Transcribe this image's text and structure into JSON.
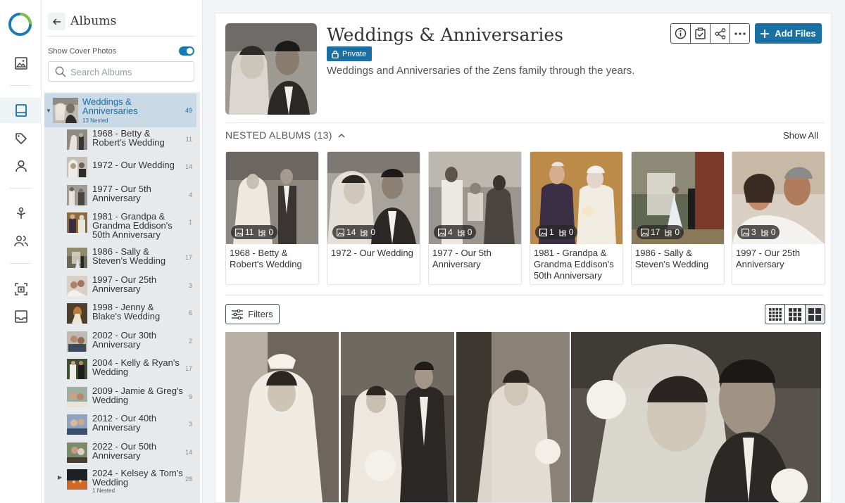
{
  "sidebar": {
    "title": "Albums",
    "show_cover_label": "Show Cover Photos",
    "search_placeholder": "Search Albums",
    "root": {
      "name": "Weddings & Anniversaries",
      "sub": "13 Nested",
      "count": "49"
    },
    "items": [
      {
        "name": "1968 - Betty & Robert's Wedding",
        "count": "11"
      },
      {
        "name": "1972 - Our Wedding",
        "count": "14"
      },
      {
        "name": "1977 - Our 5th Anniversary",
        "count": "4"
      },
      {
        "name": "1981 - Grandpa & Grandma Eddison's 50th Anniversary",
        "count": "1"
      },
      {
        "name": "1986 - Sally & Steven's Wedding",
        "count": "17"
      },
      {
        "name": "1997 - Our 25th Anniversary",
        "count": "3"
      },
      {
        "name": "1998 - Jenny & Blake's Wedding",
        "count": "6"
      },
      {
        "name": "2002 - Our 30th Anniversary",
        "count": "2"
      },
      {
        "name": "2004 - Kelly & Ryan's Wedding",
        "count": "17"
      },
      {
        "name": "2009 - Jamie & Greg's Wedding",
        "count": "9"
      },
      {
        "name": "2012 - Our 40th Anniversary",
        "count": "3"
      },
      {
        "name": "2022 - Our 50th Anniversary",
        "count": "14"
      },
      {
        "name": "2024 - Kelsey & Tom's Wedding",
        "count": "28",
        "sub": "1 Nested"
      }
    ]
  },
  "album": {
    "title": "Weddings & Anniversaries",
    "privacy": "Private",
    "description": "Weddings and Anniversaries of the Zens family through the years.",
    "add_files": "Add Files"
  },
  "nested": {
    "header": "NESTED ALBUMS (13)",
    "show_all": "Show All",
    "cards": [
      {
        "name": "1968 - Betty & Robert's Wedding",
        "photos": "11",
        "albums": "0"
      },
      {
        "name": "1972 - Our Wedding",
        "photos": "14",
        "albums": "0"
      },
      {
        "name": "1977 - Our 5th Anniversary",
        "photos": "4",
        "albums": "0"
      },
      {
        "name": "1981 - Grandpa & Grandma Eddison's 50th Anniversary",
        "photos": "1",
        "albums": "0"
      },
      {
        "name": "1986 - Sally & Steven's Wedding",
        "photos": "17",
        "albums": "0"
      },
      {
        "name": "1997 - Our 25th Anniversary",
        "photos": "3",
        "albums": "0"
      }
    ]
  },
  "toolbar": {
    "filters": "Filters"
  },
  "colors": {
    "accent": "#1a6fa3",
    "active_bg": "#c9d9e5"
  }
}
